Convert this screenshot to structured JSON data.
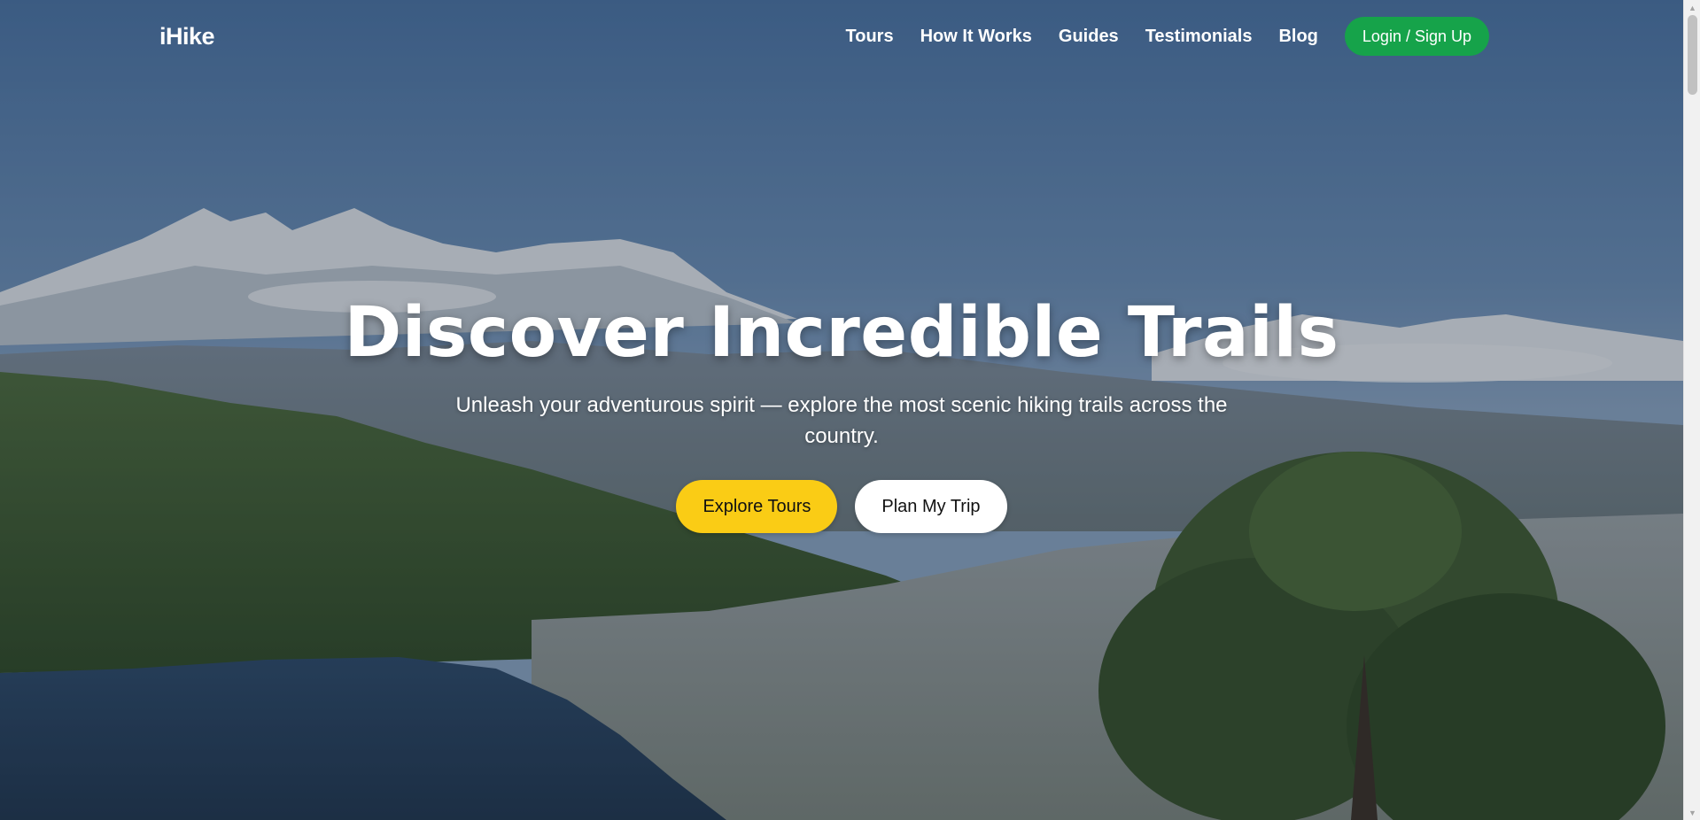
{
  "navbar": {
    "logo": "iHike",
    "links": [
      "Tours",
      "How It Works",
      "Guides",
      "Testimonials",
      "Blog"
    ],
    "login_label": "Login / Sign Up"
  },
  "hero": {
    "title": "Discover Incredible Trails",
    "subtitle": "Unleash your adventurous spirit — explore the most scenic hiking trails across the country.",
    "primary_button": "Explore Tours",
    "secondary_button": "Plan My Trip"
  },
  "colors": {
    "login_button": "#16a34a",
    "primary_button": "#facc15",
    "secondary_button": "#ffffff",
    "text": "#ffffff"
  },
  "icons": {
    "scroll_up": "triangle-up",
    "scroll_down": "triangle-down"
  }
}
